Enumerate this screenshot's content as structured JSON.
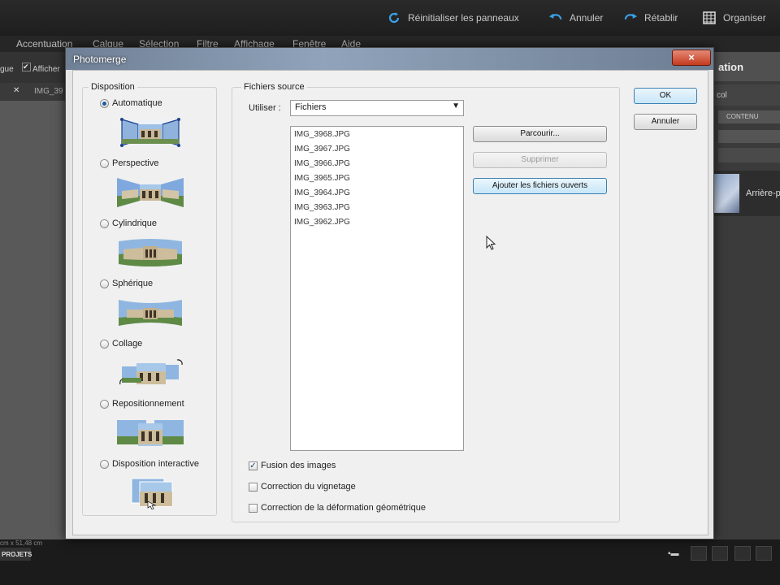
{
  "topbar": {
    "reset_label": "Réinitialiser les panneaux",
    "undo_label": "Annuler",
    "redo_label": "Rétablir",
    "organizer_label": "Organiser"
  },
  "menubar": {
    "items": [
      "Accentuation",
      "Calque",
      "Sélection",
      "Filtre",
      "Affichage",
      "Fenêtre",
      "Aide"
    ]
  },
  "options_bar": {
    "left_label": "gue",
    "show_label": "Afficher"
  },
  "document_tab": {
    "label": "IMG_39"
  },
  "right_panel": {
    "header": "ation",
    "tab_label": "CONTENU",
    "partial_label": "col",
    "layer_label": "Arrière-p"
  },
  "status_bar": {
    "text": "cm x 51,48 cm",
    "tab_label": "PROJETS"
  },
  "dialog": {
    "title": "Photomerge",
    "close_label": "×",
    "disposition": {
      "legend": "Disposition",
      "selected": "Automatique",
      "modes": [
        {
          "label": "Automatique",
          "selected": true
        },
        {
          "label": "Perspective",
          "selected": false
        },
        {
          "label": "Cylindrique",
          "selected": false
        },
        {
          "label": "Sphérique",
          "selected": false
        },
        {
          "label": "Collage",
          "selected": false
        },
        {
          "label": "Repositionnement",
          "selected": false
        },
        {
          "label": "Disposition interactive",
          "selected": false
        }
      ]
    },
    "source": {
      "legend": "Fichiers source",
      "use_label": "Utiliser :",
      "use_value": "Fichiers",
      "files": [
        "IMG_3968.JPG",
        "IMG_3967.JPG",
        "IMG_3966.JPG",
        "IMG_3965.JPG",
        "IMG_3964.JPG",
        "IMG_3963.JPG",
        "IMG_3962.JPG"
      ],
      "browse_label": "Parcourir...",
      "remove_label": "Supprimer",
      "add_open_label": "Ajouter les fichiers ouverts"
    },
    "options": [
      {
        "label": "Fusion des images",
        "checked": true
      },
      {
        "label": "Correction du vignetage",
        "checked": false
      },
      {
        "label": "Correction de la déformation géométrique",
        "checked": false
      }
    ],
    "ok_label": "OK",
    "cancel_label": "Annuler"
  },
  "colors": {
    "app_bg": "#1c1c1c",
    "dialog_bg": "#f0f0f0",
    "accent_blue": "#3c7fb1",
    "close_red": "#c43b1f"
  }
}
